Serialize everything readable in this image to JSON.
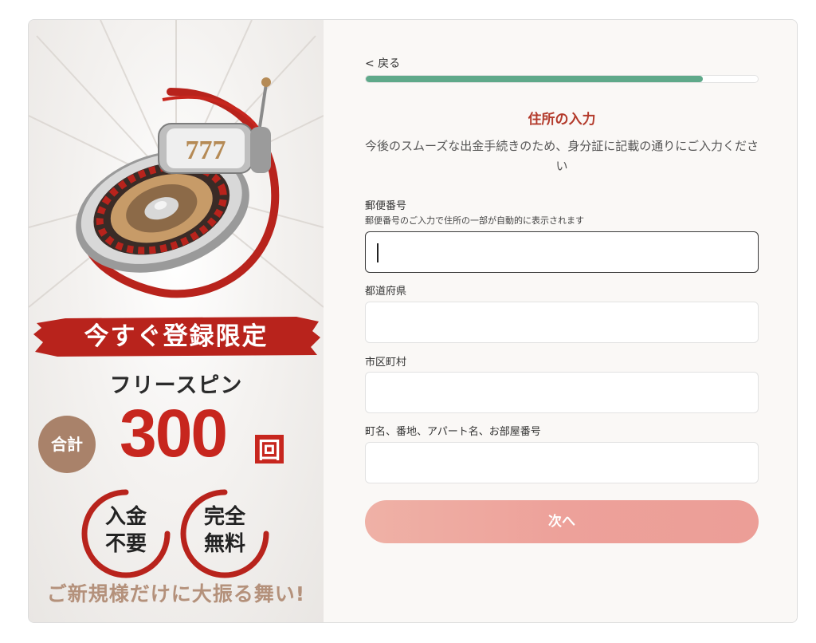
{
  "promo": {
    "slot_digits": "777",
    "banner": "今すぐ登録限定",
    "freespin_label": "フリースピン",
    "total_badge": "合計",
    "count": "300",
    "count_unit": "回",
    "badge_left": {
      "line1": "入金",
      "line2": "不要"
    },
    "badge_right": {
      "line1": "完全",
      "line2": "無料"
    },
    "tagline": "ご新規様だけに大振る舞い!"
  },
  "form": {
    "back_label": "< 戻る",
    "progress": 0.86,
    "title": "住所の入力",
    "subtitle": "今後のスムーズな出金手続きのため、身分証に記載の通りにご入力ください",
    "fields": [
      {
        "label": "郵便番号",
        "hint": "郵便番号のご入力で住所の一部が自動的に表示されます",
        "value": ""
      },
      {
        "label": "都道府県",
        "value": ""
      },
      {
        "label": "市区町村",
        "value": ""
      },
      {
        "label": "町名、番地、アパート名、お部屋番号",
        "value": ""
      }
    ],
    "next_label": "次へ"
  },
  "colors": {
    "accent_red": "#c7261e",
    "progress_green": "#5fa98a",
    "button_pink": "#eda19a",
    "title_red": "#b33a2b",
    "badge_brown": "#a9826a"
  }
}
